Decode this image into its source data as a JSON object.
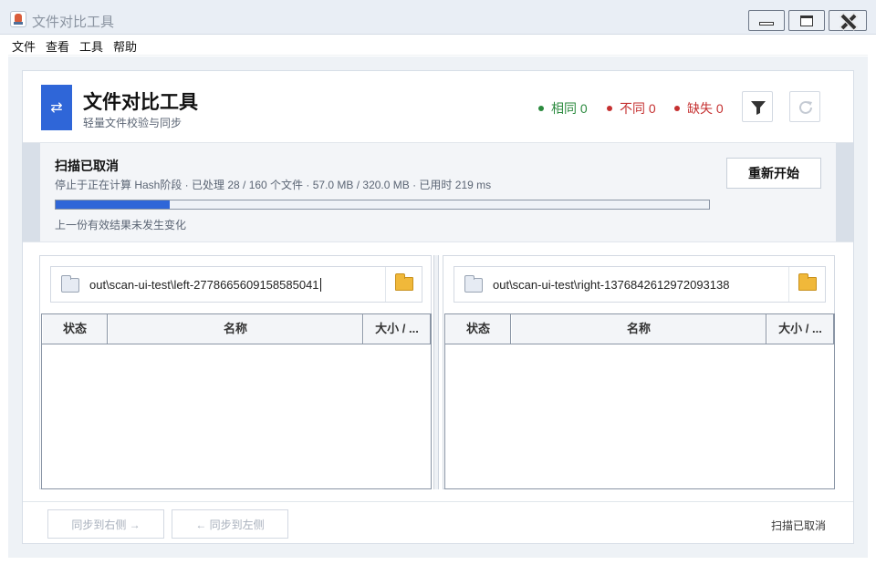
{
  "window": {
    "title": "文件对比工具"
  },
  "menu": {
    "items": [
      {
        "label": "文件"
      },
      {
        "label": "查看"
      },
      {
        "label": "工具"
      },
      {
        "label": "帮助"
      }
    ]
  },
  "header": {
    "title": "文件对比工具",
    "subtitle": "轻量文件校验与同步",
    "stats": {
      "same": "相同 0",
      "diff": "不同 0",
      "missing": "缺失 0"
    }
  },
  "scan": {
    "title": "扫描已取消",
    "detail": "停止于正在计算 Hash阶段 · 已处理 28 / 160 个文件 · 57.0 MB / 320.0 MB · 已用时 219 ms",
    "progress_fraction": 0.175,
    "note": "上一份有效结果未发生变化",
    "restart_label": "重新开始"
  },
  "panels": {
    "left": {
      "path": "out\\scan-ui-test\\left-2778665609158585041"
    },
    "right": {
      "path": "out\\scan-ui-test\\right-1376842612972093138"
    },
    "columns": [
      "状态",
      "名称",
      "大小 / ..."
    ]
  },
  "footer": {
    "sync_right": "同步到右侧 →",
    "sync_left": "← 同步到左侧",
    "status": "扫描已取消"
  },
  "colors": {
    "accent": "#2f66d8",
    "same": "#2b8a3e",
    "diff": "#c53030"
  }
}
